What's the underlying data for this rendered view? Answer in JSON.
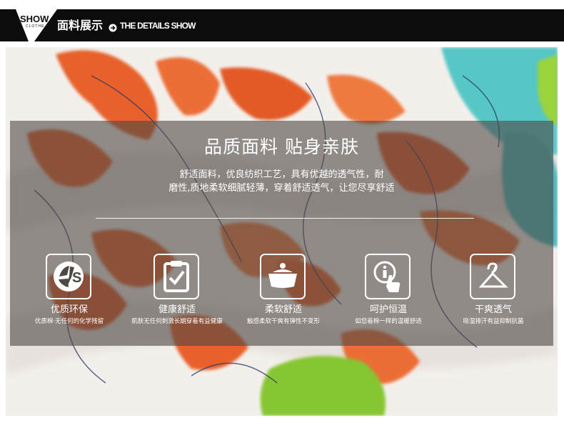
{
  "header": {
    "logo_show": "SHOW",
    "logo_clothe": "CLOTHE",
    "title": "面料展示",
    "subtitle": "THE DETAILS SHOW"
  },
  "panel": {
    "headline": "品质面料  贴身亲肤",
    "description_line1": "舒适面料，优良纺织工艺，具有优越的透气性，耐",
    "description_line2": "磨性,质地柔软细腻轻薄，穿着舒适透气，让您尽享舒适"
  },
  "features": [
    {
      "title": "优质环保",
      "subtitle": "优质棉·无任何的化学残留",
      "icon": "eco-leaf-icon"
    },
    {
      "title": "健康舒适",
      "subtitle": "肌肤无任何刺激长期穿着有益健康",
      "icon": "clipboard-check-icon"
    },
    {
      "title": "柔软舒适",
      "subtitle": "触感柔软干爽有弹性不变形",
      "icon": "soft-pot-icon"
    },
    {
      "title": "呵护恒温",
      "subtitle": "如您着棉一样的温暖舒适",
      "icon": "hand-info-icon"
    },
    {
      "title": "干爽透气",
      "subtitle": "吸湿排汗有益抑制抗菌",
      "icon": "hanger-icon"
    }
  ],
  "colors": {
    "header_bg": "#0c0c0c",
    "panel_overlay": "rgba(78,72,68,0.60)",
    "fabric_orange": "#e8612a",
    "fabric_teal": "#4ec3c4",
    "fabric_green": "#86c632"
  }
}
